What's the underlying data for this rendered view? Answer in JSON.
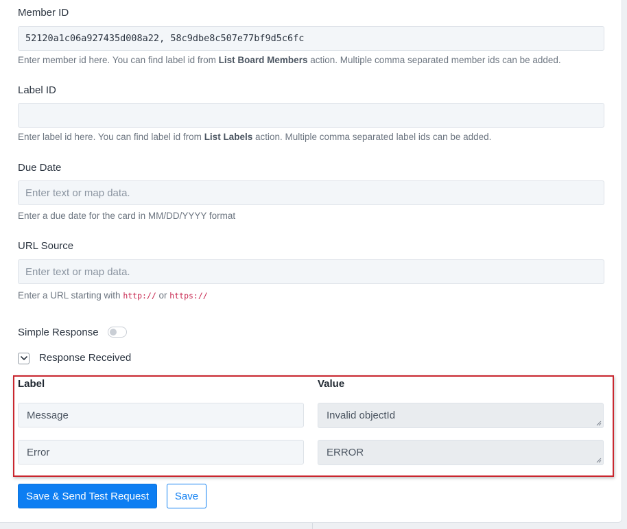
{
  "fields": {
    "member_id": {
      "label": "Member ID",
      "value": "52120a1c06a927435d008a22, 58c9dbe8c507e77bf9d5c6fc",
      "help_prefix": "Enter member id here. You can find label id from ",
      "help_bold": "List Board Members",
      "help_suffix": " action. Multiple comma separated member ids can be added."
    },
    "label_id": {
      "label": "Label ID",
      "value": "",
      "help_prefix": "Enter label id here. You can find label id from ",
      "help_bold": "List Labels",
      "help_suffix": " action. Multiple comma separated label ids can be added."
    },
    "due_date": {
      "label": "Due Date",
      "placeholder": "Enter text or map data.",
      "help": "Enter a due date for the card in MM/DD/YYYY format"
    },
    "url_source": {
      "label": "URL Source",
      "placeholder": "Enter text or map data.",
      "help_prefix": "Enter a URL starting with ",
      "code1": "http://",
      "help_mid": " or ",
      "code2": "https://"
    }
  },
  "simple_response": {
    "label": "Simple Response",
    "enabled": false
  },
  "response_received": {
    "label": "Response Received",
    "expanded": true
  },
  "response_table": {
    "header_label": "Label",
    "header_value": "Value",
    "rows": [
      {
        "label": "Message",
        "value": "Invalid objectId"
      },
      {
        "label": "Error",
        "value": "ERROR"
      }
    ],
    "highlight_color": "#c9262e"
  },
  "buttons": {
    "save_send": "Save & Send Test Request",
    "save": "Save"
  },
  "colors": {
    "primary": "#0d7ef2"
  }
}
